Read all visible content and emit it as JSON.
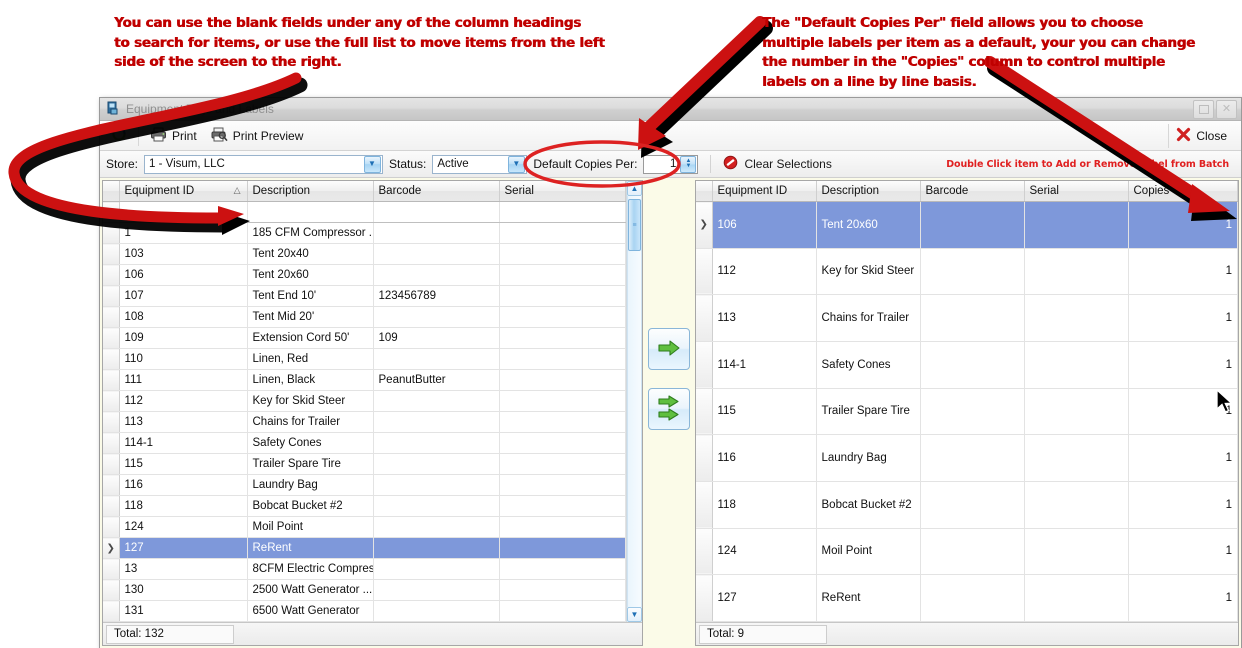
{
  "annotations": {
    "left": "You can use the blank fields under any of the column headings\nto search for items, or use the full list to move items from the left\nside of the screen to the right.",
    "right": "The \"Default Copies Per\" field allows you to choose\nmultiple labels per item as a default, your you can change\nthe number in the \"Copies\" column to control multiple\nlabels on a line by line basis.",
    "color": "#c00000"
  },
  "window": {
    "title": "Equipment Tags and Labels",
    "icon": "labels-icon",
    "maximize_label": "",
    "close_label": ""
  },
  "toolbar": {
    "refresh_label": "",
    "print_label": "Print",
    "print_preview_label": "Print Preview",
    "close_label": "Close"
  },
  "filterbar": {
    "store_label": "Store:",
    "store_value": "1 - Visum, LLC",
    "status_label": "Status:",
    "status_value": "Active",
    "copies_label": "Default Copies Per:",
    "copies_value": "1",
    "clear_selections_label": "Clear Selections",
    "hint": "Double Click item to Add or Remove Label from Batch",
    "hint_color": "#e02020"
  },
  "move_buttons": {
    "move_selected_label": "",
    "move_all_label": ""
  },
  "left_grid": {
    "columns": [
      "Equipment ID",
      "Description",
      "Barcode",
      "Serial"
    ],
    "sorted_column": "Equipment ID",
    "sort_indicator": "△",
    "filter_row": [
      "",
      "",
      "",
      ""
    ],
    "rows": [
      {
        "id": "1",
        "description": "185 CFM Compressor ...",
        "barcode": "",
        "serial": "",
        "selected": false
      },
      {
        "id": "103",
        "description": "Tent 20x40",
        "barcode": "",
        "serial": "",
        "selected": false
      },
      {
        "id": "106",
        "description": "Tent 20x60",
        "barcode": "",
        "serial": "",
        "selected": false
      },
      {
        "id": "107",
        "description": "Tent End 10'",
        "barcode": "123456789",
        "serial": "",
        "selected": false
      },
      {
        "id": "108",
        "description": "Tent Mid 20'",
        "barcode": "",
        "serial": "",
        "selected": false
      },
      {
        "id": "109",
        "description": "Extension Cord 50'",
        "barcode": "109",
        "serial": "",
        "selected": false
      },
      {
        "id": "110",
        "description": "Linen, Red",
        "barcode": "",
        "serial": "",
        "selected": false
      },
      {
        "id": "111",
        "description": "Linen, Black",
        "barcode": "PeanutButter",
        "serial": "",
        "selected": false
      },
      {
        "id": "112",
        "description": "Key for Skid Steer",
        "barcode": "",
        "serial": "",
        "selected": false
      },
      {
        "id": "113",
        "description": "Chains for Trailer",
        "barcode": "",
        "serial": "",
        "selected": false
      },
      {
        "id": "114-1",
        "description": "Safety Cones",
        "barcode": "",
        "serial": "",
        "selected": false
      },
      {
        "id": "115",
        "description": "Trailer Spare Tire",
        "barcode": "",
        "serial": "",
        "selected": false
      },
      {
        "id": "116",
        "description": "Laundry Bag",
        "barcode": "",
        "serial": "",
        "selected": false
      },
      {
        "id": "118",
        "description": "Bobcat Bucket #2",
        "barcode": "",
        "serial": "",
        "selected": false
      },
      {
        "id": "124",
        "description": "Moil Point",
        "barcode": "",
        "serial": "",
        "selected": false
      },
      {
        "id": "127",
        "description": "ReRent",
        "barcode": "",
        "serial": "",
        "selected": true
      },
      {
        "id": "13",
        "description": "8CFM Electric Compres...",
        "barcode": "",
        "serial": "",
        "selected": false
      },
      {
        "id": "130",
        "description": "2500 Watt Generator ...",
        "barcode": "",
        "serial": "",
        "selected": false
      },
      {
        "id": "131",
        "description": "6500 Watt Generator",
        "barcode": "",
        "serial": "",
        "selected": false
      }
    ],
    "total_label": "Total: 132"
  },
  "right_grid": {
    "columns": [
      "Equipment ID",
      "Description",
      "Barcode",
      "Serial",
      "Copies"
    ],
    "rows": [
      {
        "id": "106",
        "description": "Tent 20x60",
        "barcode": "",
        "serial": "",
        "copies": "1",
        "selected": true
      },
      {
        "id": "112",
        "description": "Key for Skid Steer",
        "barcode": "",
        "serial": "",
        "copies": "1",
        "selected": false
      },
      {
        "id": "113",
        "description": "Chains for Trailer",
        "barcode": "",
        "serial": "",
        "copies": "1",
        "selected": false
      },
      {
        "id": "114-1",
        "description": "Safety Cones",
        "barcode": "",
        "serial": "",
        "copies": "1",
        "selected": false
      },
      {
        "id": "115",
        "description": "Trailer Spare Tire",
        "barcode": "",
        "serial": "",
        "copies": "1",
        "selected": false
      },
      {
        "id": "116",
        "description": "Laundry Bag",
        "barcode": "",
        "serial": "",
        "copies": "1",
        "selected": false
      },
      {
        "id": "118",
        "description": "Bobcat Bucket #2",
        "barcode": "",
        "serial": "",
        "copies": "1",
        "selected": false
      },
      {
        "id": "124",
        "description": "Moil Point",
        "barcode": "",
        "serial": "",
        "copies": "1",
        "selected": false
      },
      {
        "id": "127",
        "description": "ReRent",
        "barcode": "",
        "serial": "",
        "copies": "1",
        "selected": false
      }
    ],
    "total_label": "Total: 9"
  },
  "colors": {
    "selection_blue": "#7e98da",
    "annotation_red": "#c00000",
    "pane_background": "#fbfbe8"
  }
}
